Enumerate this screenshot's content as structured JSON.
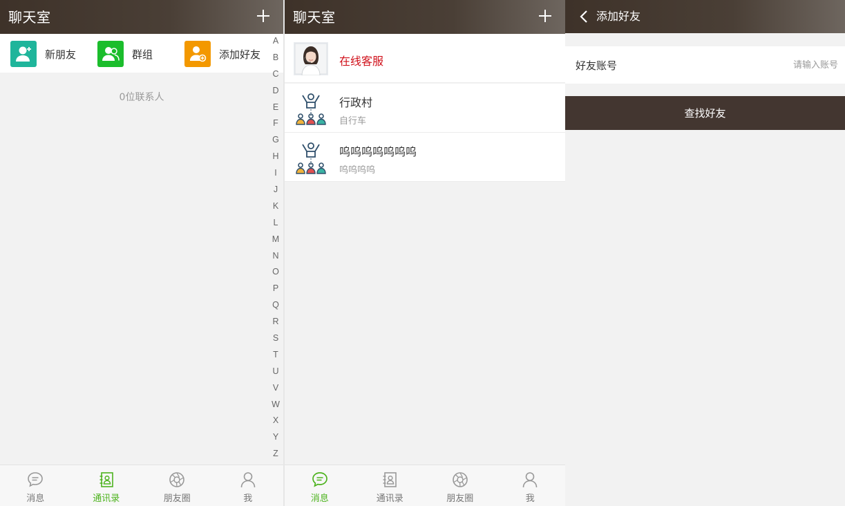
{
  "colors": {
    "header": "#433630",
    "accent_green": "#4db31e",
    "highlight_red": "#d0101a",
    "teal": "#1fb59b",
    "green": "#1bbd2c",
    "orange": "#f39800"
  },
  "contacts": {
    "title": "聊天室",
    "quick": [
      {
        "label": "新朋友",
        "icon": "new-friend-icon"
      },
      {
        "label": "群组",
        "icon": "group-icon"
      },
      {
        "label": "添加好友",
        "icon": "add-friend-icon"
      }
    ],
    "count_text": "0位联系人",
    "alphabet": [
      "A",
      "B",
      "C",
      "D",
      "E",
      "F",
      "G",
      "H",
      "I",
      "J",
      "K",
      "L",
      "M",
      "N",
      "O",
      "P",
      "Q",
      "R",
      "S",
      "T",
      "U",
      "V",
      "W",
      "X",
      "Y",
      "Z"
    ]
  },
  "messages": {
    "title": "聊天室",
    "items": [
      {
        "name": "在线客服",
        "sub": ""
      },
      {
        "name": "行政村",
        "sub": "自行车"
      },
      {
        "name": "呜呜呜呜呜呜呜",
        "sub": "呜呜呜呜"
      }
    ]
  },
  "add_friend": {
    "title": "添加好友",
    "field_label": "好友账号",
    "field_placeholder": "请输入账号",
    "button": "查找好友"
  },
  "tabs": [
    {
      "label": "消息",
      "icon": "chat-bubble-icon"
    },
    {
      "label": "通讯录",
      "icon": "address-book-icon"
    },
    {
      "label": "朋友圈",
      "icon": "aperture-icon"
    },
    {
      "label": "我",
      "icon": "person-icon"
    }
  ],
  "active_tab": {
    "panel1": "通讯录",
    "panel2": "消息"
  }
}
